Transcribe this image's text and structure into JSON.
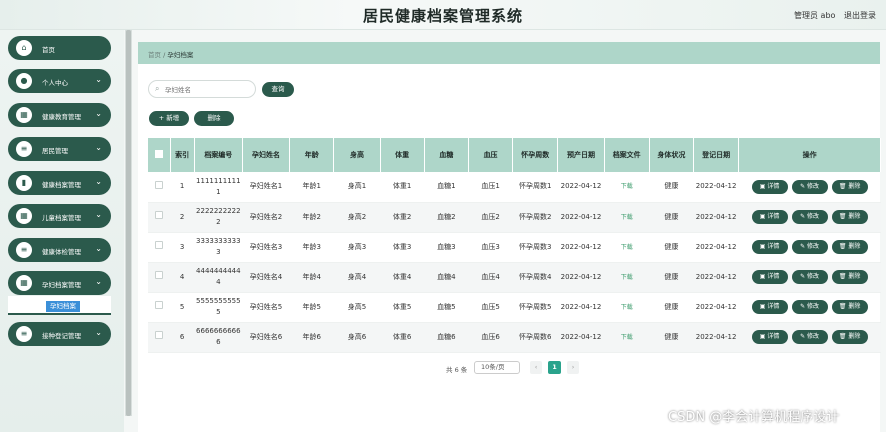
{
  "header": {
    "title": "居民健康档案管理系统",
    "user": "管理员 abo",
    "logout": "退出登录"
  },
  "sidebar": {
    "items": [
      {
        "label": "首页",
        "icon": "home-icon",
        "glyph": "⌂",
        "chevron": ""
      },
      {
        "label": "个人中心",
        "icon": "user-icon",
        "glyph": "●",
        "chevron": "⌄"
      },
      {
        "label": "健康教育管理",
        "icon": "grid-icon",
        "glyph": "▦",
        "chevron": "⌄"
      },
      {
        "label": "居民管理",
        "icon": "list-icon",
        "glyph": "≡",
        "chevron": "⌄"
      },
      {
        "label": "健康档案管理",
        "icon": "chart-icon",
        "glyph": "▮",
        "chevron": "⌄"
      },
      {
        "label": "儿童档案管理",
        "icon": "grid-icon",
        "glyph": "▦",
        "chevron": "⌄"
      },
      {
        "label": "健康体检管理",
        "icon": "list-icon",
        "glyph": "≡",
        "chevron": "⌄"
      },
      {
        "label": "孕妇档案管理",
        "icon": "grid-icon",
        "glyph": "▦",
        "chevron": "⌄"
      },
      {
        "label": "接种登记管理",
        "icon": "list-icon",
        "glyph": "≡",
        "chevron": "⌄"
      }
    ],
    "submenu_label": "孕妇档案"
  },
  "breadcrumb": {
    "home": "首页",
    "sep": "/",
    "current": "孕妇档案"
  },
  "search": {
    "placeholder": "孕妇姓名",
    "button": "查询"
  },
  "toolbar": {
    "add": "+ 新增",
    "delete": "删除"
  },
  "table": {
    "columns": [
      "",
      "索引",
      "档案编号",
      "孕妇姓名",
      "年龄",
      "身高",
      "体重",
      "血糖",
      "血压",
      "怀孕周数",
      "预产日期",
      "档案文件",
      "身体状况",
      "登记日期",
      "操作"
    ],
    "rows": [
      {
        "idx": "1",
        "no": "11111111111",
        "name": "孕妇姓名1",
        "age": "年龄1",
        "height": "身高1",
        "weight": "体重1",
        "sugar": "血糖1",
        "bp": "血压1",
        "weeks": "怀孕周数1",
        "due": "2022-04-12",
        "file": "下载",
        "status": "健康",
        "reg": "2022-04-12"
      },
      {
        "idx": "2",
        "no": "22222222222",
        "name": "孕妇姓名2",
        "age": "年龄2",
        "height": "身高2",
        "weight": "体重2",
        "sugar": "血糖2",
        "bp": "血压2",
        "weeks": "怀孕周数2",
        "due": "2022-04-12",
        "file": "下载",
        "status": "健康",
        "reg": "2022-04-12"
      },
      {
        "idx": "3",
        "no": "33333333333",
        "name": "孕妇姓名3",
        "age": "年龄3",
        "height": "身高3",
        "weight": "体重3",
        "sugar": "血糖3",
        "bp": "血压3",
        "weeks": "怀孕周数3",
        "due": "2022-04-12",
        "file": "下载",
        "status": "健康",
        "reg": "2022-04-12"
      },
      {
        "idx": "4",
        "no": "44444444444",
        "name": "孕妇姓名4",
        "age": "年龄4",
        "height": "身高4",
        "weight": "体重4",
        "sugar": "血糖4",
        "bp": "血压4",
        "weeks": "怀孕周数4",
        "due": "2022-04-12",
        "file": "下载",
        "status": "健康",
        "reg": "2022-04-12"
      },
      {
        "idx": "5",
        "no": "55555555555",
        "name": "孕妇姓名5",
        "age": "年龄5",
        "height": "身高5",
        "weight": "体重5",
        "sugar": "血糖5",
        "bp": "血压5",
        "weeks": "怀孕周数5",
        "due": "2022-04-12",
        "file": "下载",
        "status": "健康",
        "reg": "2022-04-12"
      },
      {
        "idx": "6",
        "no": "66666666666",
        "name": "孕妇姓名6",
        "age": "年龄6",
        "height": "身高6",
        "weight": "体重6",
        "sugar": "血糖6",
        "bp": "血压6",
        "weeks": "怀孕周数6",
        "due": "2022-04-12",
        "file": "下载",
        "status": "健康",
        "reg": "2022-04-12"
      }
    ],
    "ops": {
      "detail": "详情",
      "edit": "修改",
      "delete": "删除"
    }
  },
  "pagination": {
    "total": "共 6 条",
    "page_size": "10条/页",
    "prev": "‹",
    "current": "1",
    "next": "›"
  },
  "watermark": "CSDN @李会计算机程序设计",
  "colors": {
    "primary": "#2b5a4c",
    "header_row": "#aed6c9",
    "accent": "#2aa38c"
  }
}
